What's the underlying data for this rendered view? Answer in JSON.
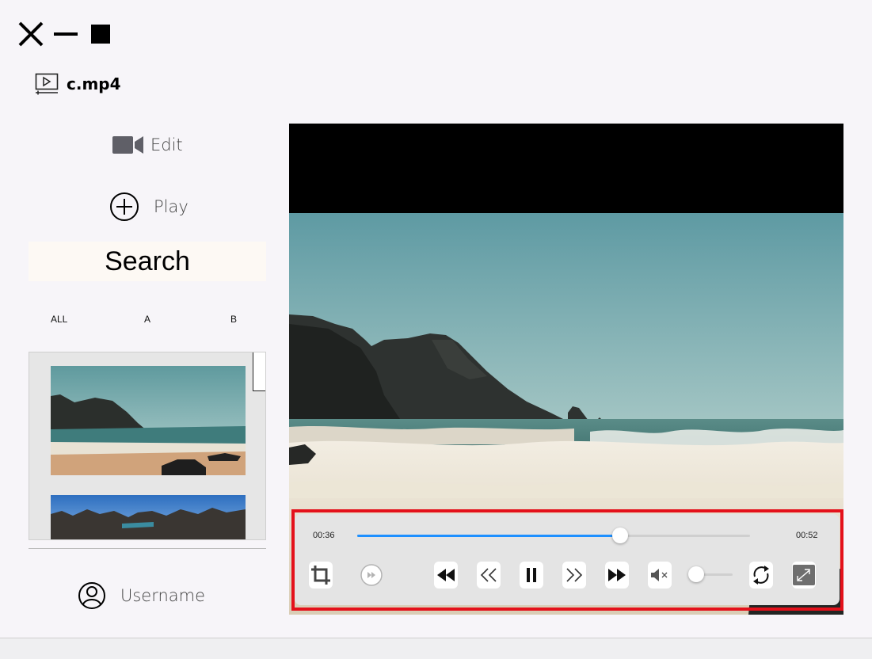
{
  "window": {
    "file_name": "c.mp4"
  },
  "sidebar": {
    "edit_label": "Edit",
    "play_label": "Play",
    "search_label": "Search",
    "filters": [
      "ALL",
      "A",
      "B"
    ],
    "thumbnails": [
      "beach-thumbnail",
      "rocks-thumbnail"
    ],
    "username_label": "Username"
  },
  "player": {
    "current_time": "00:36",
    "total_time": "00:52",
    "progress_fraction": 0.67,
    "volume_fraction": 0.0,
    "muted": true,
    "accent_color": "#1e90ff",
    "highlight_color": "#e4111b",
    "icons": [
      "crop-icon",
      "fast-forward-circle-icon",
      "rewind-icon",
      "step-back-icon",
      "pause-icon",
      "step-forward-icon",
      "fast-forward-icon",
      "mute-icon",
      "repeat-icon",
      "fullscreen-icon"
    ]
  }
}
